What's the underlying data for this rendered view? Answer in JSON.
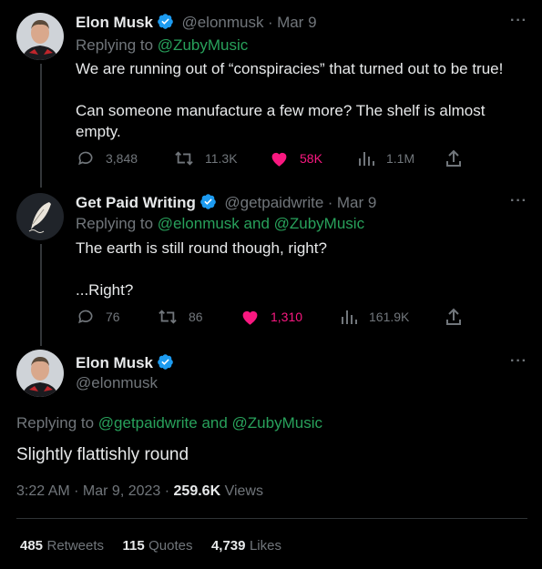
{
  "tweets": [
    {
      "name": "Elon Musk",
      "handle": "@elonmusk",
      "sep": "·",
      "date": "Mar 9",
      "replying_prefix": "Replying to",
      "replying_to": "@ZubyMusic",
      "text": "We are running out of “conspiracies” that turned out to be true!\n\nCan someone manufacture a few more? The shelf is almost\nempty.",
      "replies": "3,848",
      "retweets": "11.3K",
      "likes": "58K",
      "views": "1.1M",
      "more": "···"
    },
    {
      "name": "Get Paid Writing",
      "handle": "@getpaidwrite",
      "sep": "·",
      "date": "Mar 9",
      "replying_prefix": "Replying to",
      "replying_to": "@elonmusk and @ZubyMusic",
      "text": "The earth is still round though, right?\n\n...Right?",
      "replies": "76",
      "retweets": "86",
      "likes": "1,310",
      "views": "161.9K",
      "more": "···"
    }
  ],
  "main": {
    "name": "Elon Musk",
    "handle": "@elonmusk",
    "replying_prefix": "Replying to",
    "replying_to": "@getpaidwrite and @ZubyMusic",
    "text": "Slightly flattishly round",
    "time": "3:22 AM · Mar 9, 2023 ·",
    "views_count": "259.6K",
    "views_label": "Views",
    "more": "···"
  },
  "stats": {
    "retweets_count": "485",
    "retweets_label": "Retweets",
    "quotes_count": "115",
    "quotes_label": "Quotes",
    "likes_count": "4,739",
    "likes_label": "Likes"
  },
  "colors": {
    "link": "#28a15b",
    "like": "#f91880",
    "verified": "#1d9bf0",
    "muted": "#71767b"
  }
}
